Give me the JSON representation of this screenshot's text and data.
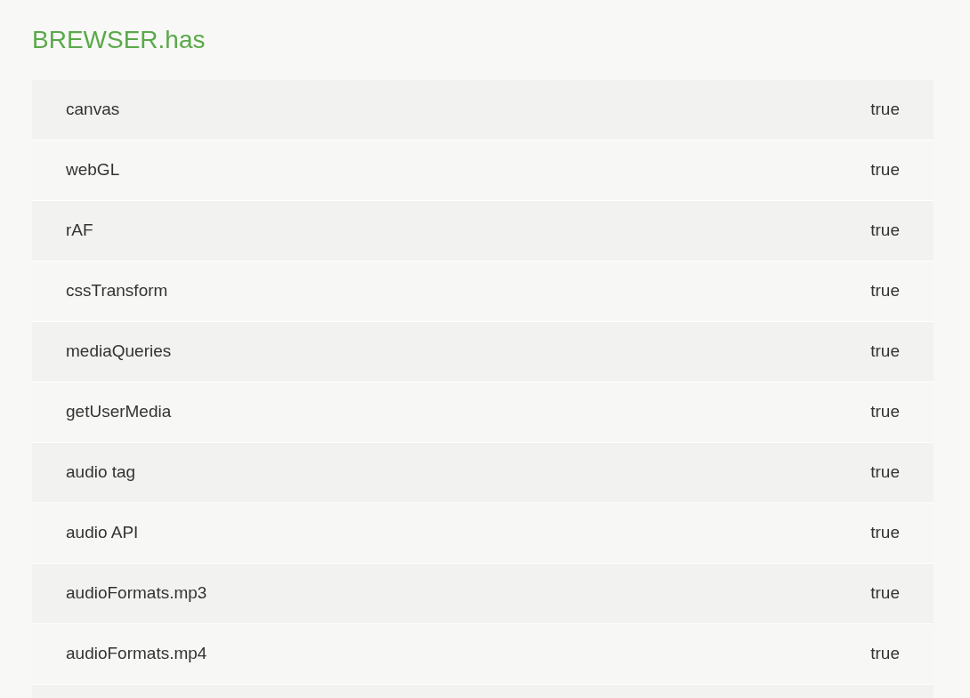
{
  "title": "BREWSER.has",
  "rows": [
    {
      "name": "canvas",
      "value": "true"
    },
    {
      "name": "webGL",
      "value": "true"
    },
    {
      "name": "rAF",
      "value": "true"
    },
    {
      "name": "cssTransform",
      "value": "true"
    },
    {
      "name": "mediaQueries",
      "value": "true"
    },
    {
      "name": "getUserMedia",
      "value": "true"
    },
    {
      "name": "audio tag",
      "value": "true"
    },
    {
      "name": "audio API",
      "value": "true"
    },
    {
      "name": "audioFormats.mp3",
      "value": "true"
    },
    {
      "name": "audioFormats.mp4",
      "value": "true"
    }
  ]
}
